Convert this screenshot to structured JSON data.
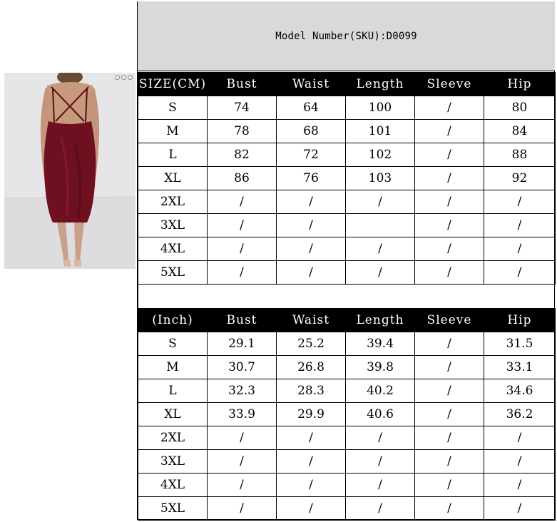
{
  "header": {
    "sku_label": "Model Number(SKU):D0099"
  },
  "photo": {
    "icon": "dress-model-photo"
  },
  "cm_table": {
    "headers": [
      "SIZE(CM)",
      "Bust",
      "Waist",
      "Length",
      "Sleeve",
      "Hip"
    ],
    "rows": [
      [
        "S",
        "74",
        "64",
        "100",
        "/",
        "80"
      ],
      [
        "M",
        "78",
        "68",
        "101",
        "/",
        "84"
      ],
      [
        "L",
        "82",
        "72",
        "102",
        "/",
        "88"
      ],
      [
        "XL",
        "86",
        "76",
        "103",
        "/",
        "92"
      ],
      [
        "2XL",
        "/",
        "/",
        "/",
        "/",
        "/"
      ],
      [
        "3XL",
        "/",
        "/",
        "",
        "/",
        "/"
      ],
      [
        "4XL",
        "/",
        "/",
        "/",
        "/",
        "/"
      ],
      [
        "5XL",
        "/",
        "/",
        "/",
        "/",
        "/"
      ]
    ]
  },
  "inch_table": {
    "headers": [
      "(Inch)",
      "Bust",
      "Waist",
      "Length",
      "Sleeve",
      "Hip"
    ],
    "rows": [
      [
        "S",
        "29.1",
        "25.2",
        "39.4",
        "/",
        "31.5"
      ],
      [
        "M",
        "30.7",
        "26.8",
        "39.8",
        "/",
        "33.1"
      ],
      [
        "L",
        "32.3",
        "28.3",
        "40.2",
        "/",
        "34.6"
      ],
      [
        "XL",
        "33.9",
        "29.9",
        "40.6",
        "/",
        "36.2"
      ],
      [
        "2XL",
        "/",
        "/",
        "/",
        "/",
        "/"
      ],
      [
        "3XL",
        "/",
        "/",
        "/",
        "/",
        "/"
      ],
      [
        "4XL",
        "/",
        "/",
        "/",
        "/",
        "/"
      ],
      [
        "5XL",
        "/",
        "/",
        "/",
        "/",
        "/"
      ]
    ]
  }
}
